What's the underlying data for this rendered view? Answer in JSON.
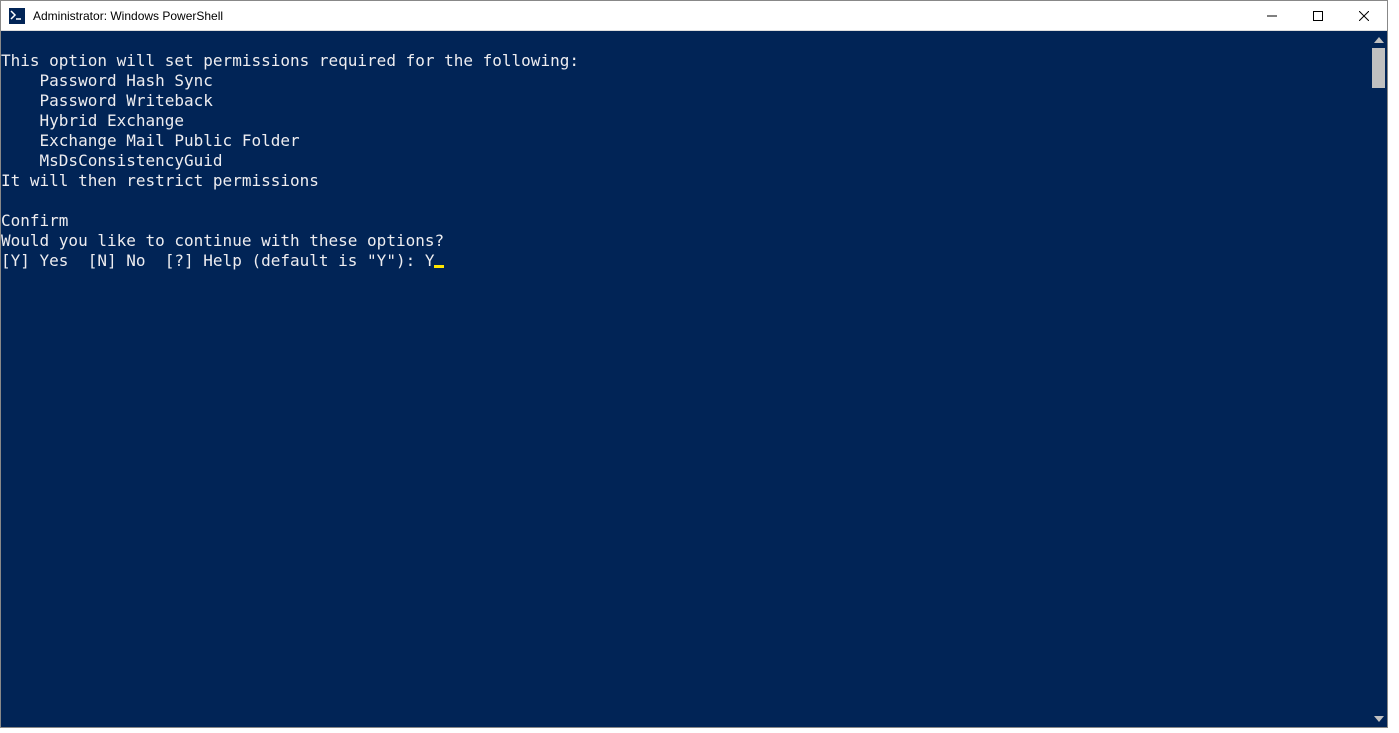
{
  "window": {
    "title": "Administrator: Windows PowerShell"
  },
  "console": {
    "line_blank1": "",
    "line_header": "This option will set permissions required for the following:",
    "line_item1": "    Password Hash Sync",
    "line_item2": "    Password Writeback",
    "line_item3": "    Hybrid Exchange",
    "line_item4": "    Exchange Mail Public Folder",
    "line_item5": "    MsDsConsistencyGuid",
    "line_restrict": "It will then restrict permissions",
    "line_blank2": "",
    "line_confirm": "Confirm",
    "line_question": "Would you like to continue with these options?",
    "prompt_options": "[Y] Yes  [N] No  [?] Help (default is \"Y\"): ",
    "user_input": "Y"
  }
}
